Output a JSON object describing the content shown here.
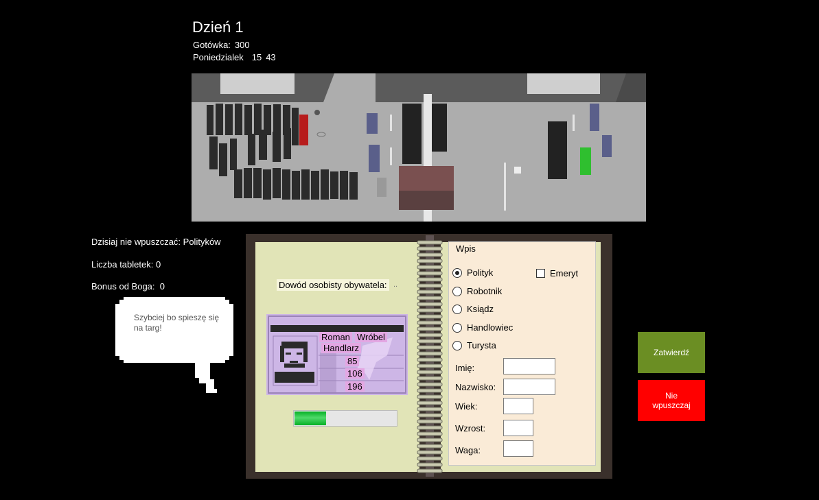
{
  "header": {
    "day_title": "Dzień 1",
    "cash_label": "Gotówka:",
    "cash_value": "300",
    "weekday": "Poniedzialek",
    "hour": "15",
    "minute": "43"
  },
  "info": {
    "rule_text": "Dzisiaj nie wpuszczać: Polityków",
    "pills_label": "Liczba tabletek:",
    "pills_value": "0",
    "bonus_label": "Bonus od Boga:",
    "bonus_value": "0"
  },
  "bubble": {
    "text": "Szybciej bo spieszę się na targ!"
  },
  "document": {
    "label": "Dowód osobisty obywatela:",
    "dots": "..",
    "first_name": "Roman",
    "last_name": "Wróbel",
    "profession": "Handlarz",
    "age": "85",
    "height": "106",
    "weight": "196"
  },
  "progress": {
    "fraction": 0.32
  },
  "form": {
    "group_title": "Wpis",
    "options": [
      {
        "label": "Polityk",
        "selected": true
      },
      {
        "label": "Robotnik",
        "selected": false
      },
      {
        "label": "Ksiądz",
        "selected": false
      },
      {
        "label": "Handlowiec",
        "selected": false
      },
      {
        "label": "Turysta",
        "selected": false
      }
    ],
    "retired_label": "Emeryt",
    "retired_checked": false,
    "fields": {
      "first_name_label": "Imię:",
      "last_name_label": "Nazwisko:",
      "age_label": "Wiek:",
      "height_label": "Wzrost:",
      "weight_label": "Waga:"
    }
  },
  "buttons": {
    "confirm": "Zatwierdź",
    "reject": "Nie wpuszczaj"
  },
  "colors": {
    "confirm_bg": "#6b8e23",
    "reject_bg": "#ff0000",
    "progress_fill": "#06b025",
    "page_bg": "#e1e4b7",
    "form_bg": "#faebd7",
    "card_bg": "#cdb6e6"
  }
}
